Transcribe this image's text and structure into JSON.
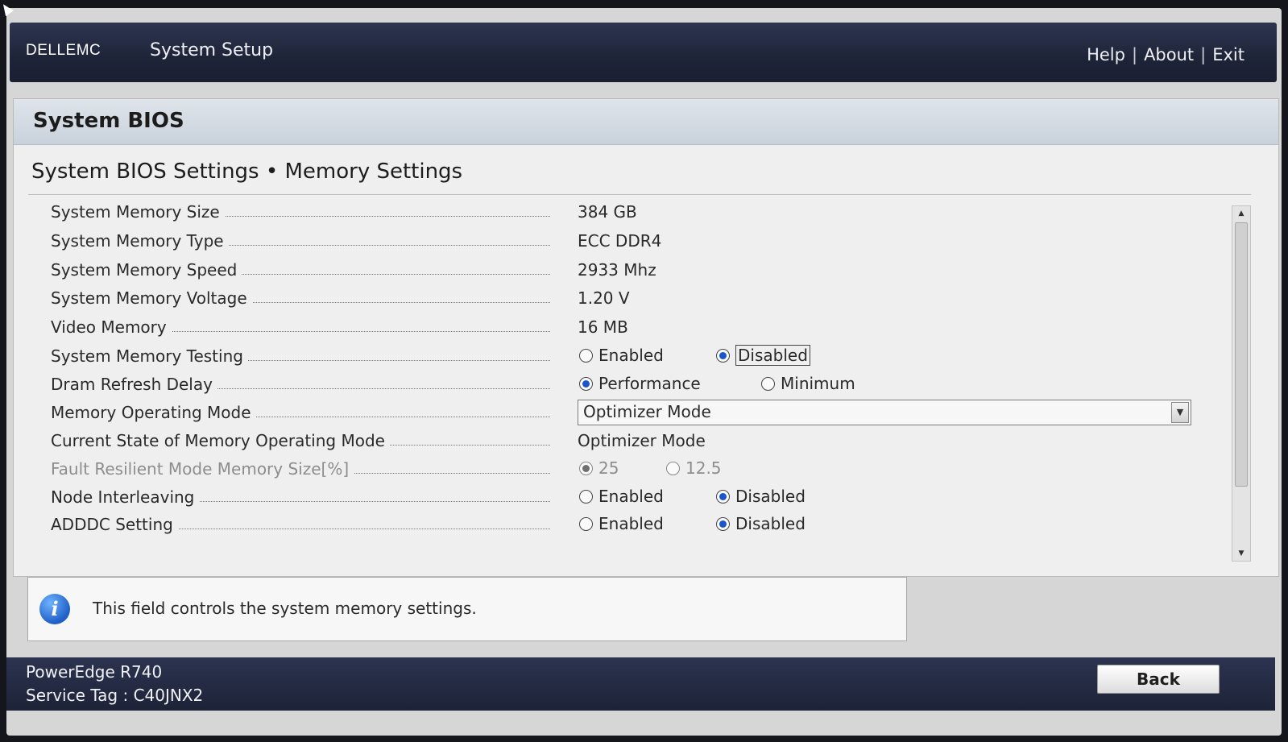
{
  "header": {
    "logo": "DELLEMC",
    "app_title": "System Setup",
    "links": {
      "help": "Help",
      "about": "About",
      "exit": "Exit",
      "separator": "|"
    }
  },
  "panel": {
    "title": "System BIOS",
    "subtitle": "System BIOS Settings • Memory Settings"
  },
  "settings": [
    {
      "label": "System Memory Size",
      "value": "384 GB"
    },
    {
      "label": "System Memory Type",
      "value": "ECC DDR4"
    },
    {
      "label": "System Memory Speed",
      "value": "2933 Mhz"
    },
    {
      "label": "System Memory Voltage",
      "value": "1.20 V"
    },
    {
      "label": "Video Memory",
      "value": "16 MB"
    },
    {
      "label": "System Memory Testing",
      "options": [
        "Enabled",
        "Disabled"
      ],
      "selected": "Disabled"
    },
    {
      "label": "Dram Refresh Delay",
      "options": [
        "Performance",
        "Minimum"
      ],
      "selected": "Performance"
    },
    {
      "label": "Memory Operating Mode",
      "dropdown_value": "Optimizer Mode"
    },
    {
      "label": "Current State of Memory Operating Mode",
      "value": "Optimizer Mode"
    },
    {
      "label": "Fault Resilient Mode Memory Size[%]",
      "options": [
        "25",
        "12.5"
      ],
      "selected": "25",
      "disabled": true
    },
    {
      "label": "Node Interleaving",
      "options": [
        "Enabled",
        "Disabled"
      ],
      "selected": "Disabled"
    },
    {
      "label": "ADDDC Setting",
      "options": [
        "Enabled",
        "Disabled"
      ],
      "selected": "Disabled"
    }
  ],
  "info": {
    "icon": "info-icon",
    "text": "This field controls the system memory settings."
  },
  "footer": {
    "model": "PowerEdge R740",
    "service_tag": "Service Tag : C40JNX2",
    "back_label": "Back"
  },
  "colors": {
    "header_bg": "#1e2438",
    "panel_bg": "#efefef",
    "radio_selected": "#1a56c9"
  }
}
